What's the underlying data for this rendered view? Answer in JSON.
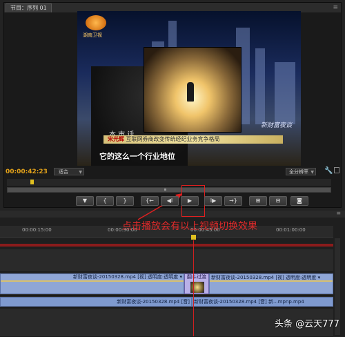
{
  "monitor": {
    "tab_label": "节目：序列 01",
    "timecode": "00:00:42:23",
    "zoom": "适合",
    "quality": "全分辨率",
    "video": {
      "logo_text": "湖南卫视",
      "studio_text": "本 市 话",
      "channel_tag": "新财富夜谈",
      "banner_name": "宋光辉",
      "banner_text": "互联网券商改变传统经纪业务竞争格局",
      "subtitle": "它的这么一个行业地位"
    },
    "transport": [
      {
        "name": "add-marker-button",
        "glyph": "▼"
      },
      {
        "name": "mark-in-button",
        "glyph": "{"
      },
      {
        "name": "mark-out-button",
        "glyph": "}"
      },
      {
        "name": "go-to-in-button",
        "glyph": "{←"
      },
      {
        "name": "step-back-button",
        "glyph": "◀I"
      },
      {
        "name": "play-button",
        "glyph": "▶"
      },
      {
        "name": "step-forward-button",
        "glyph": "I▶"
      },
      {
        "name": "go-to-out-button",
        "glyph": "→}"
      },
      {
        "name": "lift-button",
        "glyph": "⊞"
      },
      {
        "name": "extract-button",
        "glyph": "⊟"
      },
      {
        "name": "export-frame-button",
        "glyph": "◙"
      }
    ]
  },
  "timeline": {
    "ruler_labels": [
      "00:00:15:00",
      "00:00:30:00",
      "00:00:45:00",
      "00:01:00:00"
    ],
    "clips": {
      "video_left": "新财富夜谈-20150328.mp4 [视] 透明度:透明度 ▾",
      "transition": "翻斗过渡",
      "video_right": "新财富夜谈-20150328.mp4 [视] 透明度:透明度 ▾",
      "audio_left": "新财富夜谈-20150328.mp4 [音]",
      "audio_right": "新财富夜谈-20150328.mp4 [音] 新...mpnp.mp4"
    }
  },
  "annotation": "点击播放会有以上视频切换效果",
  "watermark": "头条 @云天777",
  "colors": {
    "timecode": "#e3a21a",
    "annotation": "#e02a2a",
    "clip_video": "#8fa6d6",
    "work_area": "#8b1b1b"
  }
}
